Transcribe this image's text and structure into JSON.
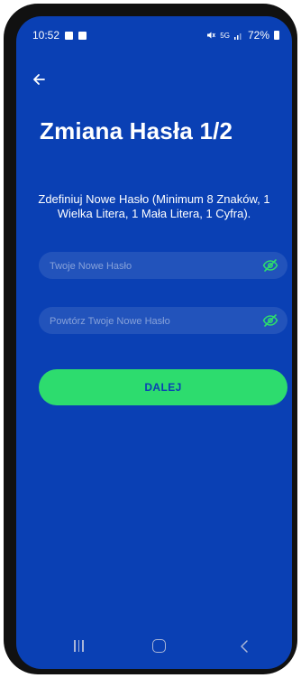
{
  "status": {
    "time": "10:52",
    "network": "5G",
    "battery": "72%"
  },
  "header": {
    "title": "Zmiana Hasła 1/2"
  },
  "description": "Zdefiniuj Nowe Hasło (Minimum 8 Znaków, 1 Wielka Litera, 1 Mała Litera, 1 Cyfra).",
  "fields": {
    "new_password": {
      "placeholder": "Twoje Nowe Hasło",
      "value": ""
    },
    "repeat_password": {
      "placeholder": "Powtórz Twoje Nowe Hasło",
      "value": ""
    }
  },
  "submit": {
    "label": "DALEJ"
  },
  "icons": {
    "back": "arrow-left-icon",
    "visibility": "eye-off-icon",
    "nav": [
      "recents-icon",
      "home-icon",
      "back-icon"
    ]
  },
  "colors": {
    "background": "#0a40b4",
    "accent": "#2ddc6e",
    "field": "#2a58c0"
  }
}
